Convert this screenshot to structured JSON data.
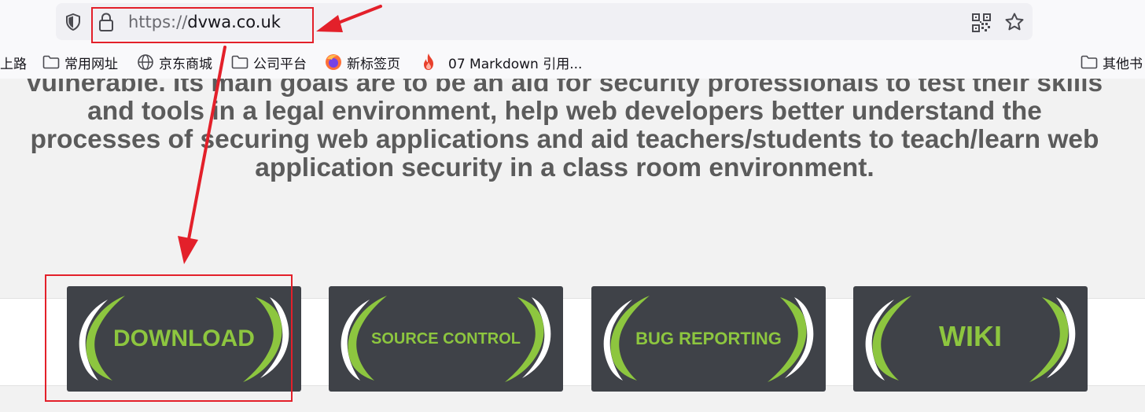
{
  "browser": {
    "url_protocol": "https://",
    "url_host": "dvwa.co.uk",
    "icons": {
      "shield": "shield-icon",
      "lock": "lock-icon",
      "qr": "qr-code-icon",
      "star": "bookmark-star-icon"
    }
  },
  "bookmarks": {
    "items": [
      {
        "label": "上路",
        "icon": "none"
      },
      {
        "label": "常用网址",
        "icon": "folder-icon"
      },
      {
        "label": "京东商城",
        "icon": "globe-icon"
      },
      {
        "label": "公司平台",
        "icon": "folder-icon"
      },
      {
        "label": "新标签页",
        "icon": "firefox-icon"
      },
      {
        "label": "07 Markdown 引用...",
        "icon": "flame-icon"
      }
    ],
    "other": {
      "label": "其他书",
      "icon": "folder-icon"
    }
  },
  "content": {
    "intro_lines": [
      "vulnerable. Its main goals are to be an aid for security professionals to test their skills",
      "and tools in a legal environment, help web developers better understand the",
      "processes of securing web applications and aid teachers/students to teach/learn web",
      "application security in a class room environment."
    ],
    "tiles": [
      {
        "label": "DOWNLOAD"
      },
      {
        "label": "SOURCE CONTROL"
      },
      {
        "label": "BUG REPORTING"
      },
      {
        "label": "WIKI"
      }
    ]
  },
  "colors": {
    "annotation": "#e3202a",
    "tile_background": "#3f4248",
    "tile_text": "#8dc63f",
    "body_text": "#5b5b5b"
  }
}
